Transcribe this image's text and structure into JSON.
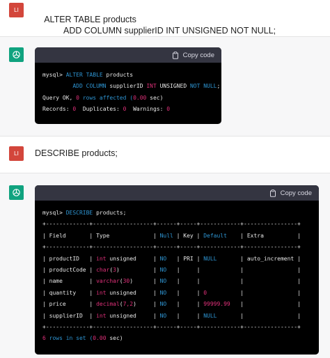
{
  "messages": [
    {
      "user_avatar": "LI",
      "user_text_line1": "ALTER TABLE products",
      "user_text_line2": "        ADD COLUMN supplierID INT UNSIGNED NOT NULL;"
    },
    {
      "user_avatar": "LI",
      "user_text": "DESCRIBE products;"
    }
  ],
  "copy_label": "Copy code",
  "code1": {
    "l1_prompt": "mysql> ",
    "l1_kw1": "ALTER TABLE",
    "l1_rest": " products",
    "l2_indent": "         ",
    "l2_kw": "ADD COLUMN",
    "l2_mid": " supplierID ",
    "l2_int": "INT",
    "l2_mid2": " UNSIGNED ",
    "l2_kw2": "NOT NULL",
    "l2_end": ";",
    "l3_a": "Query OK, ",
    "l3_n": "0",
    "l3_b": " rows affected (",
    "l3_t": "0.00",
    "l3_c": " sec)",
    "l4_a": "Records: ",
    "l4_n1": "0",
    "l4_b": "  Duplicates: ",
    "l4_n2": "0",
    "l4_c": "  Warnings: ",
    "l4_n3": "0"
  },
  "code2": {
    "prompt_line": "mysql> DESCRIBE products;",
    "border": "+-------------+------------------+------+-----+------------+----------------+",
    "headers": [
      "Field",
      "Type",
      "Null",
      "Key",
      "Default",
      "Extra"
    ],
    "rows": [
      {
        "field": "productID",
        "type": "int unsigned",
        "null": "NO",
        "key": "PRI",
        "default": "NULL",
        "extra": "auto_increment"
      },
      {
        "field": "productCode",
        "type": "char(3)",
        "null": "NO",
        "key": "",
        "default": "",
        "extra": ""
      },
      {
        "field": "name",
        "type": "varchar(30)",
        "null": "NO",
        "key": "",
        "default": "",
        "extra": ""
      },
      {
        "field": "quantity",
        "type": "int unsigned",
        "null": "NO",
        "key": "",
        "default": "0",
        "extra": ""
      },
      {
        "field": "price",
        "type": "decimal(7,2)",
        "null": "NO",
        "key": "",
        "default": "99999.99",
        "extra": ""
      },
      {
        "field": "supplierID",
        "type": "int unsigned",
        "null": "NO",
        "key": "",
        "default": "NULL",
        "extra": ""
      }
    ],
    "footer_n": "6",
    "footer_a": " rows in set (",
    "footer_t": "0.00",
    "footer_b": " sec)"
  },
  "colors": {
    "user_avatar": "#d3463b",
    "bot_avatar": "#10a37f",
    "code_bg": "#000000",
    "code_header": "#343541",
    "keyword": "#2e95d3",
    "number": "#df3079"
  }
}
